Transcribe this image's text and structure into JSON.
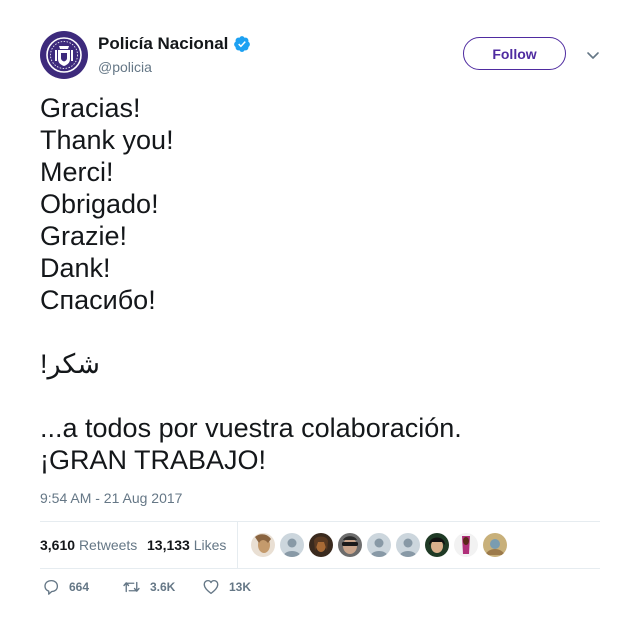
{
  "header": {
    "display_name": "Policía Nacional",
    "handle": "@policia",
    "follow_label": "Follow",
    "verified": true,
    "verified_color": "#1da1f2",
    "avatar_bg": "#3d2a7c",
    "accent": "#4f2ba0"
  },
  "tweet": {
    "text": "Gracias!\nThank you!\nMerci!\nObrigado!\nGrazie!\nDank!\nСпасибо!\n\n!شكر\n\n...a todos por vuestra colaboración.\n¡GRAN TRABAJO!",
    "timestamp": "9:54 AM - 21 Aug 2017"
  },
  "stats": {
    "retweets_count": "3,610",
    "retweets_label": "Retweets",
    "likes_count": "13,133",
    "likes_label": "Likes",
    "liker_avatars": [
      "photo",
      "default",
      "photo",
      "photo",
      "default",
      "default",
      "photo",
      "photo",
      "photo"
    ]
  },
  "actions": {
    "reply_icon": "reply-icon",
    "reply_count": "664",
    "retweet_icon": "retweet-icon",
    "retweet_count": "3.6K",
    "like_icon": "heart-icon",
    "like_count": "13K"
  }
}
